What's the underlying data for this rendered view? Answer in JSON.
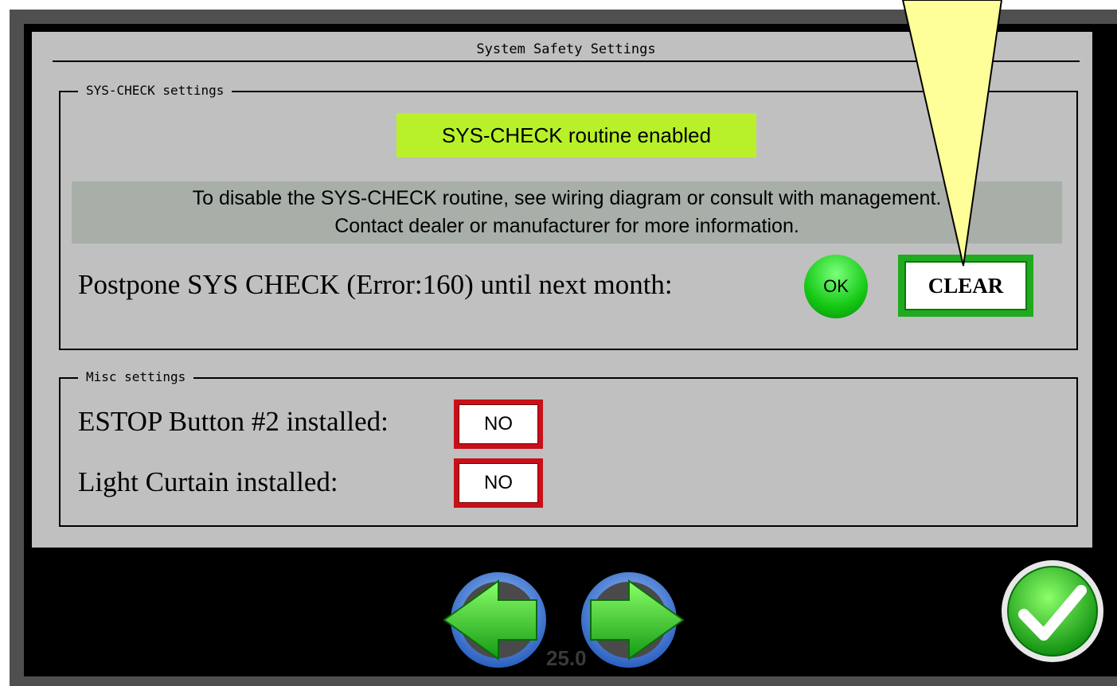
{
  "dialog": {
    "title": "System Safety Settings"
  },
  "syscheck_group": {
    "legend": "SYS-CHECK settings",
    "status_badge": "SYS-CHECK routine enabled",
    "info_line1": "To disable the SYS-CHECK routine, see wiring diagram or consult with management.",
    "info_line2": "Contact dealer or manufacturer for more information.",
    "postpone_label": "Postpone SYS CHECK (Error:160) until next month:",
    "ok_label": "OK",
    "clear_label": "CLEAR"
  },
  "misc_group": {
    "legend": "Misc settings",
    "estop_label": "ESTOP Button #2 installed:",
    "estop_value": "NO",
    "light_curtain_label": "Light Curtain installed:",
    "light_curtain_value": "NO"
  },
  "footer": {
    "page_number": "25.0",
    "prev_icon": "left-arrow-icon",
    "next_icon": "right-arrow-icon",
    "confirm_icon": "checkmark-icon"
  },
  "colors": {
    "status_badge_bg": "#b8f02a",
    "ok_green": "#14c814",
    "clear_green": "#1faa1f",
    "no_red": "#c8101a",
    "callout_fill": "#ffff99"
  }
}
